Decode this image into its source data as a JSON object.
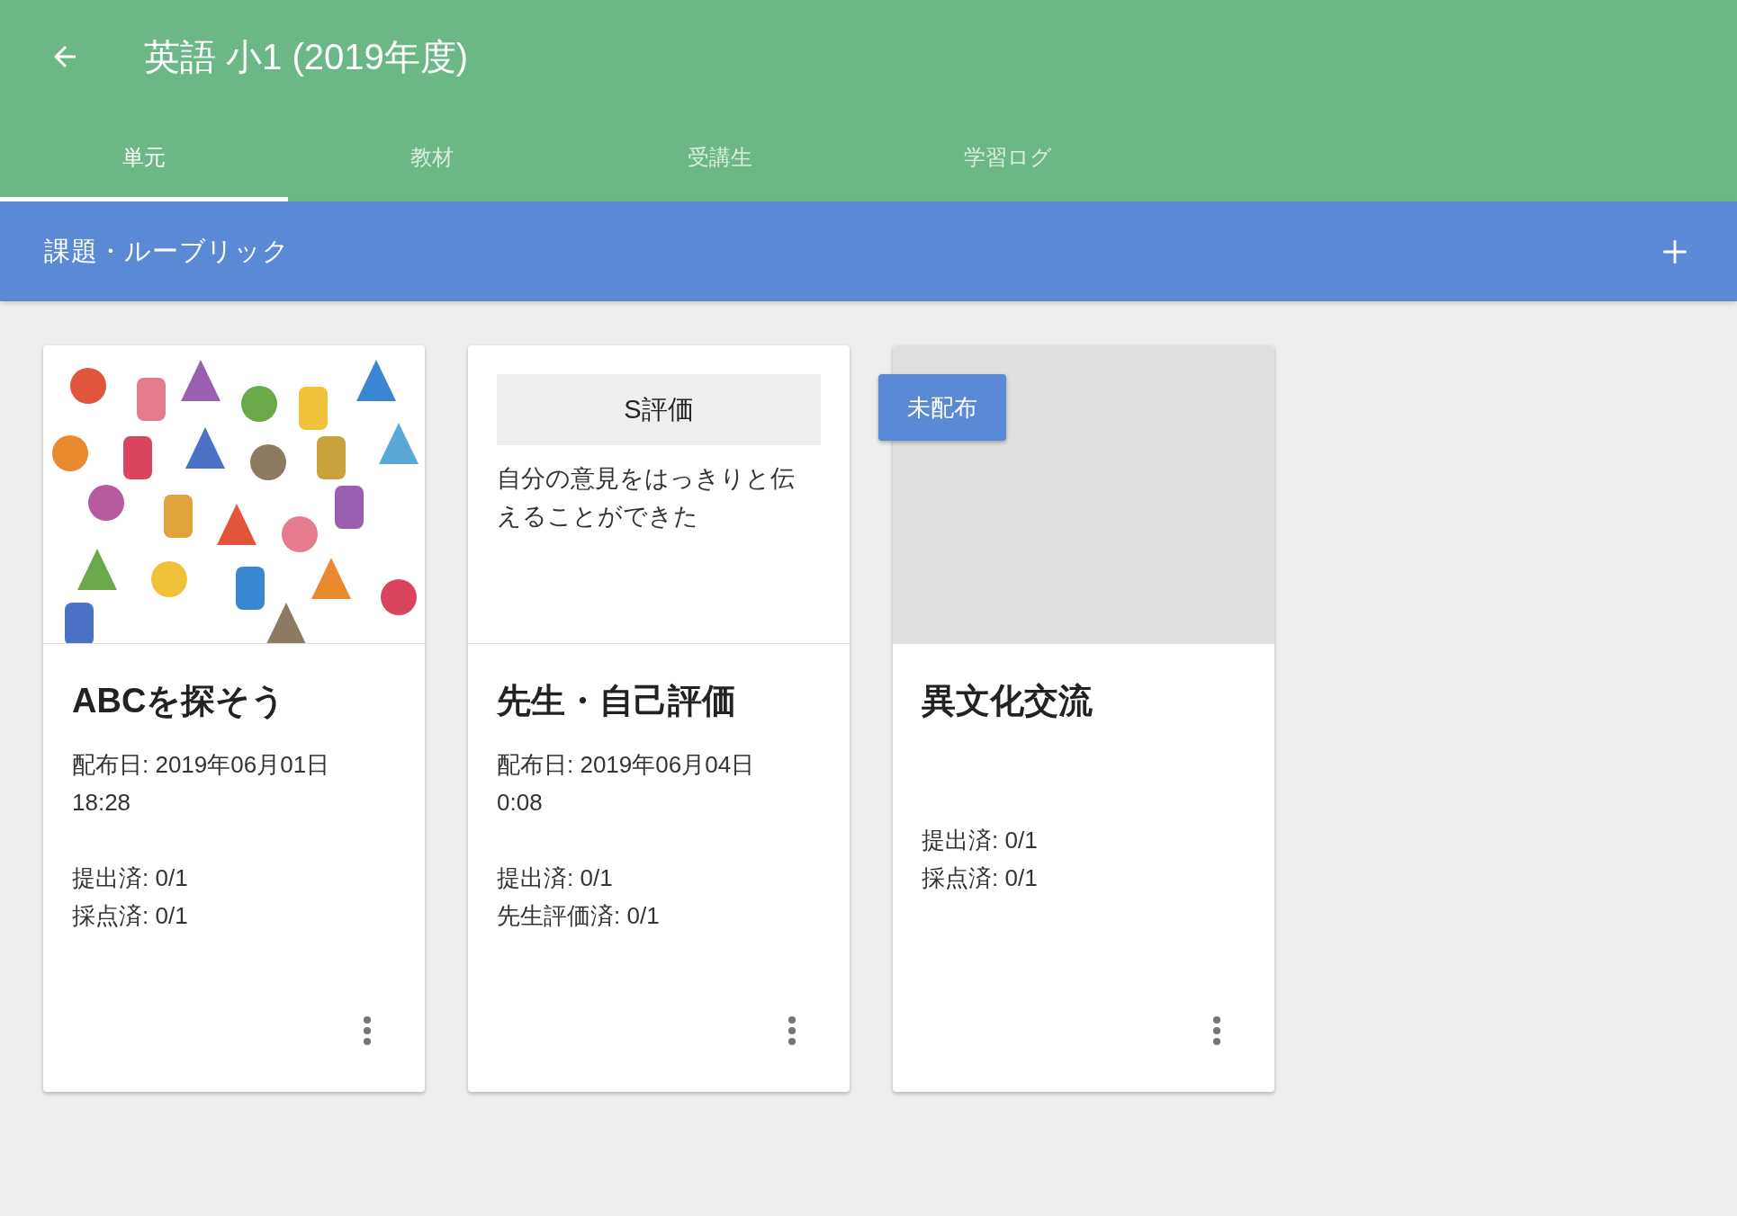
{
  "header": {
    "title": "英語 小1 (2019年度)"
  },
  "tabs": [
    {
      "label": "単元",
      "selected": true
    },
    {
      "label": "教材",
      "selected": false
    },
    {
      "label": "受講生",
      "selected": false
    },
    {
      "label": "学習ログ",
      "selected": false
    }
  ],
  "section_bar": {
    "title": "課題・ルーブリック"
  },
  "cards": [
    {
      "media": {
        "kind": "picture"
      },
      "title": "ABCを探そう",
      "date": "配布日: 2019年06月01日 18:28",
      "stats": [
        "提出済: 0/1",
        "採点済: 0/1"
      ]
    },
    {
      "media": {
        "kind": "rubric",
        "label": "S評価",
        "description": "自分の意見をはっきりと伝えることができた"
      },
      "title": "先生・自己評価",
      "date": "配布日: 2019年06月04日 0:08",
      "stats": [
        "提出済: 0/1",
        "先生評価済: 0/1"
      ]
    },
    {
      "media": {
        "kind": "blank"
      },
      "badge": "未配布",
      "title": "異文化交流",
      "stats": [
        "提出済: 0/1",
        "採点済: 0/1"
      ]
    }
  ]
}
